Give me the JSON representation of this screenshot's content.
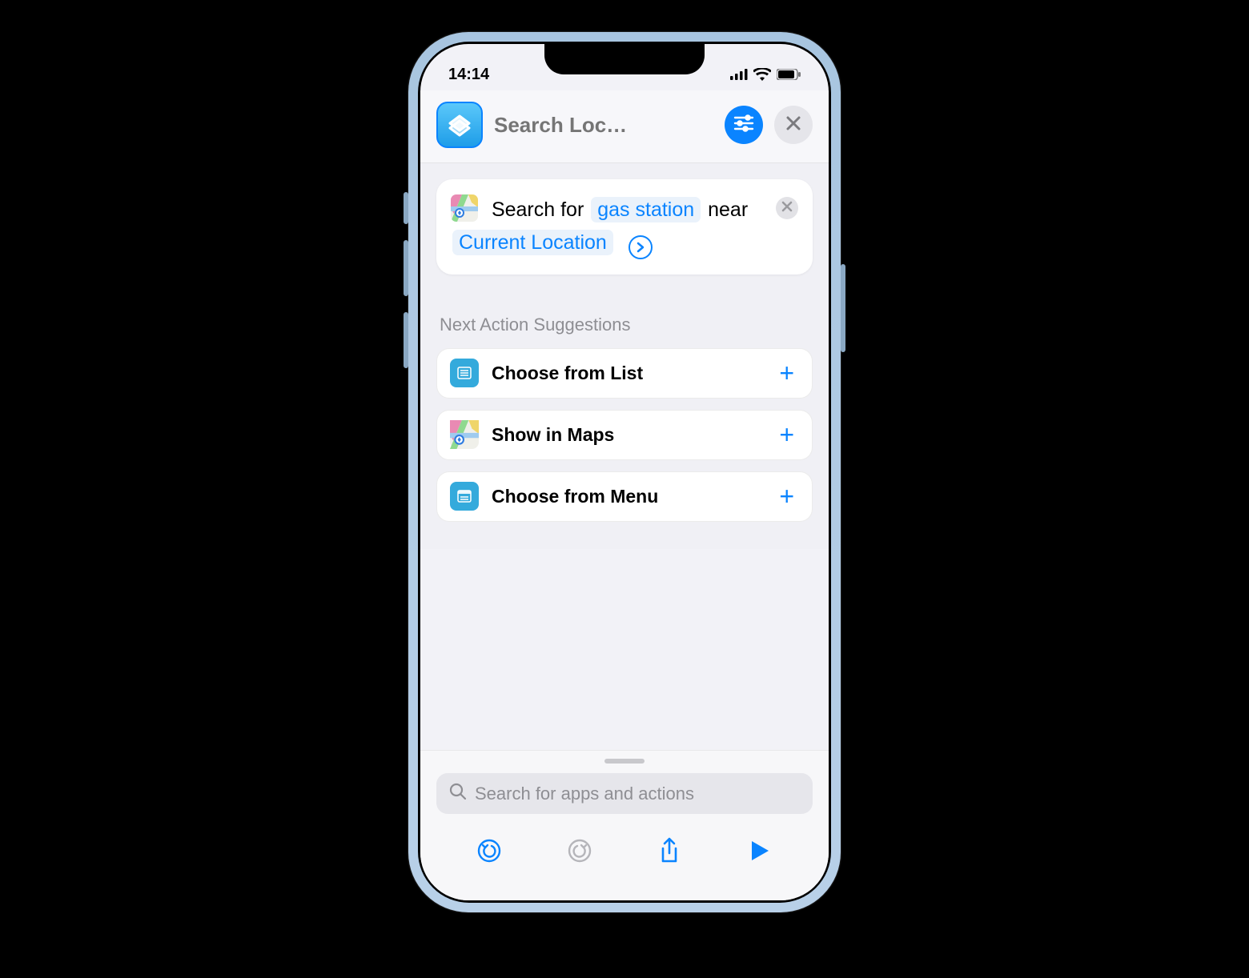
{
  "status": {
    "time": "14:14"
  },
  "header": {
    "titlePlaceholder": "Search Loc…"
  },
  "action": {
    "prefix": "Search for",
    "paramSearch": "gas station",
    "middle": "near",
    "paramLocation": "Current Location"
  },
  "suggestionsTitle": "Next Action Suggestions",
  "suggestions": [
    {
      "label": "Choose from List",
      "iconType": "list"
    },
    {
      "label": "Show in Maps",
      "iconType": "maps"
    },
    {
      "label": "Choose from Menu",
      "iconType": "menu"
    }
  ],
  "search": {
    "placeholder": "Search for apps and actions"
  }
}
